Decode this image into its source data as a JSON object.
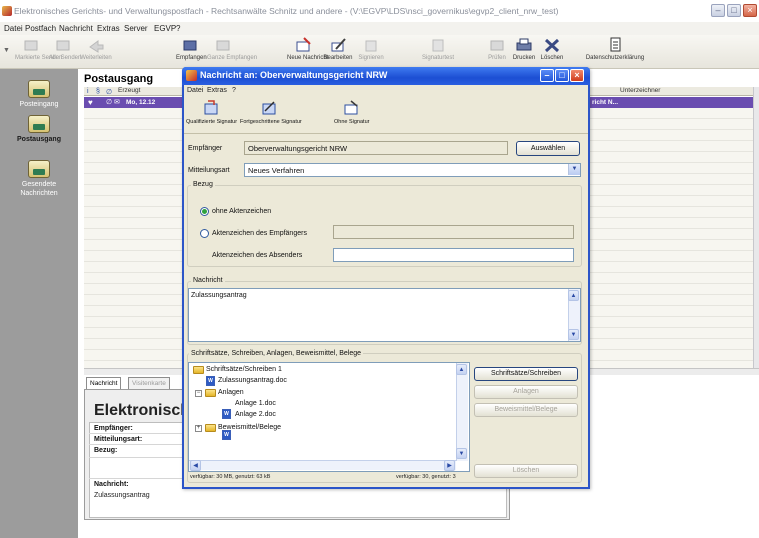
{
  "window": {
    "title": "Elektronisches Gerichts- und Verwaltungspostfach - Rechtsanwälte Schnitz und andere - (V:\\EGVP\\LDS\\nsci_governikus\\egvp2_client_nrw_test)"
  },
  "menu": [
    "Datei",
    "Postfach",
    "Nachricht",
    "Extras",
    "Server",
    "EGVP",
    "?"
  ],
  "toolbar": {
    "items": [
      {
        "label": "Markierte Senden",
        "enabled": false
      },
      {
        "label": "Alle Senden",
        "enabled": false
      },
      {
        "label": "Weiterleiten",
        "enabled": false
      },
      {
        "label": "Empfangen",
        "enabled": true
      },
      {
        "label": "Ganze Empfangen",
        "enabled": false
      },
      {
        "label": "Neue Nachricht",
        "enabled": true
      },
      {
        "label": "Bearbeiten",
        "enabled": true
      },
      {
        "label": "Signieren",
        "enabled": false
      },
      {
        "label": "Signaturtest",
        "enabled": false
      },
      {
        "label": "Prüfen",
        "enabled": false
      },
      {
        "label": "Drucken",
        "enabled": true
      },
      {
        "label": "Löschen",
        "enabled": true
      },
      {
        "label": "Datenschutzerklärung",
        "enabled": true
      }
    ]
  },
  "sidebar": {
    "items": [
      {
        "label": "Posteingang",
        "active": false
      },
      {
        "label": "Postausgang",
        "active": true
      },
      {
        "label": "Gesendete Nachrichten",
        "active": false
      }
    ]
  },
  "list": {
    "title": "Postausgang",
    "header_left": "Erzeugt",
    "header_right": "Unterzeichner",
    "row_left": "Mo, 12.12",
    "row_right": "richt N..."
  },
  "preview": {
    "tabs": [
      "Nachricht",
      "Visitenkarte"
    ],
    "title": "Elektronisch",
    "labels": [
      "Empfänger:",
      "Mitteilungsart:",
      "Bezug:",
      "Nachricht:"
    ],
    "body": "Zulassungsantrag"
  },
  "dialog": {
    "title": "Nachricht an: Oberverwaltungsgericht NRW",
    "menu": [
      "Datei",
      "Extras",
      "?"
    ],
    "toolbar": [
      "Qualifizierte Signatur",
      "Fortgeschrittene Signatur",
      "Ohne Signatur"
    ],
    "recipient_label": "Empfänger",
    "recipient_value": "Oberverwaltungsgericht NRW",
    "choose_button": "Auswählen",
    "type_label": "Mitteilungsart",
    "type_value": "Neues Verfahren",
    "reference_group": "Bezug",
    "radio_no_ref": "ohne Aktenzeichen",
    "radio_recipient_ref": "Aktenzeichen des Empfängers",
    "sender_ref_label": "Aktenzeichen des Absenders",
    "message_group": "Nachricht",
    "message_text": "Zulassungsantrag",
    "attachments_group": "Schriftsätze, Schreiben, Anlagen, Beweismittel, Belege",
    "tree": [
      {
        "label": "Schriftsätze/Schreiben 1",
        "type": "folder",
        "level": 0
      },
      {
        "label": "Zulassungsantrag.doc",
        "type": "doc",
        "level": 1
      },
      {
        "label": "Anlagen",
        "type": "folder",
        "level": 0
      },
      {
        "label": "Anlage 1.doc",
        "type": "doc",
        "level": 1
      },
      {
        "label": "Anlage 2.doc",
        "type": "doc",
        "level": 1
      },
      {
        "label": "Beweismittel/Belege",
        "type": "folder",
        "level": 0
      }
    ],
    "buttons": {
      "schriftsaetze": "Schriftsätze/Schreiben",
      "anlagen": "Anlagen",
      "beweismittel": "Beweismittel/Belege",
      "loeschen": "Löschen"
    },
    "status_left": "verfügbar: 30 MB, genutzt: 63 kB",
    "status_right": "verfügbar: 30, genutzt: 3"
  }
}
